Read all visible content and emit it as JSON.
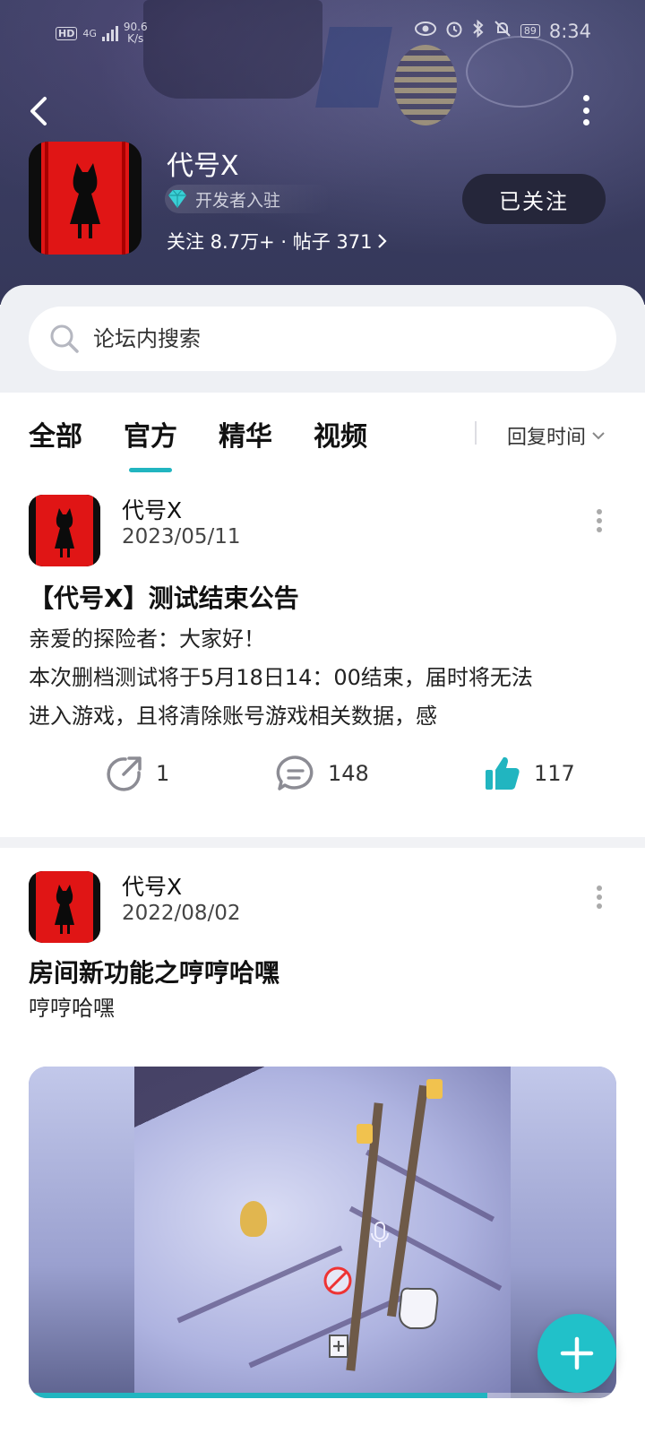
{
  "status_bar": {
    "network": "4G",
    "speed": "90.6",
    "speed_unit": "K/s",
    "battery": "89",
    "time": "8:34"
  },
  "forum": {
    "name": "代号X",
    "developer_badge": "开发者入驻",
    "stats": "关注 8.7万+ · 帖子 371",
    "follow_label": "已关注"
  },
  "search": {
    "placeholder": "论坛内搜索"
  },
  "tabs": [
    {
      "label": "全部",
      "selected": false
    },
    {
      "label": "官方",
      "selected": true
    },
    {
      "label": "精华",
      "selected": false
    },
    {
      "label": "视频",
      "selected": false
    }
  ],
  "sort": {
    "label": "回复时间"
  },
  "posts": [
    {
      "author": "代号X",
      "date": "2023/05/11",
      "title": "【代号X】测试结束公告",
      "body_lines": [
        "亲爱的探险者：大家好！",
        "本次删档测试将于5月18日14：00结束，届时将无法",
        "进入游戏，且将清除账号游戏相关数据，感"
      ],
      "shares": "1",
      "comments": "148",
      "likes": "117"
    },
    {
      "author": "代号X",
      "date": "2022/08/02",
      "title": "房间新功能之哼哼哈嘿",
      "body_lines": [
        "哼哼哈嘿"
      ],
      "video_progress": 0.78
    }
  ],
  "colors": {
    "accent": "#21b5c0",
    "fab": "#21c1c9",
    "header_bg": "#3a3c60",
    "follow_btn_bg": "#25263a",
    "like_active": "#21b5c0"
  },
  "icons": {
    "back": "chevron-left-icon",
    "more": "more-vertical-icon",
    "search": "search-icon",
    "share": "share-icon",
    "comment": "comment-icon",
    "like": "thumbs-up-icon",
    "add": "plus-icon",
    "sort_arrow": "chevron-down-icon",
    "badge": "diamond-icon"
  }
}
